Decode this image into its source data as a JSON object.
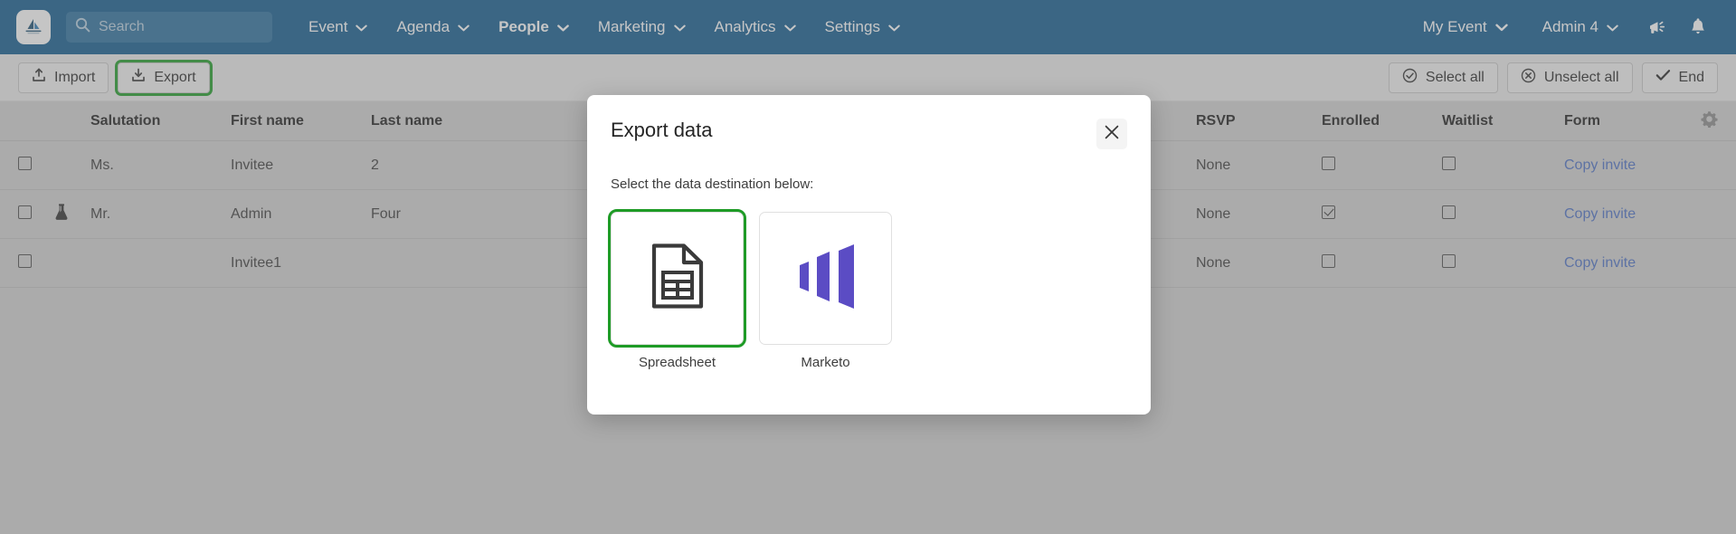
{
  "navbar": {
    "logo_icon": "app-logo-icon",
    "search": {
      "placeholder": "Search",
      "value": "",
      "icon": "search-icon"
    },
    "items": [
      {
        "label": "Event",
        "active": false
      },
      {
        "label": "Agenda",
        "active": false
      },
      {
        "label": "People",
        "active": true
      },
      {
        "label": "Marketing",
        "active": false
      },
      {
        "label": "Analytics",
        "active": false
      },
      {
        "label": "Settings",
        "active": false
      }
    ],
    "right_items": [
      {
        "label": "My Event"
      },
      {
        "label": "Admin 4"
      }
    ],
    "right_icons": [
      "megaphone-icon",
      "bell-icon"
    ],
    "background": "#115a8e"
  },
  "toolbar": {
    "import_label": "Import",
    "export_label": "Export",
    "select_all_label": "Select all",
    "unselect_all_label": "Unselect all",
    "end_label": "End",
    "highlight_color": "#1e9b26"
  },
  "table": {
    "headers": {
      "checkbox": "",
      "flask": "",
      "salutation": "Salutation",
      "first_name": "First name",
      "last_name": "Last name",
      "rsvp": "RSVP",
      "enrolled": "Enrolled",
      "waitlist": "Waitlist",
      "form": "Form",
      "gear": ""
    },
    "rows": [
      {
        "selected": false,
        "flask": false,
        "salutation": "Ms.",
        "first_name": "Invitee",
        "last_name": "2",
        "rsvp": "None",
        "enrolled": false,
        "waitlist": false,
        "form": "Copy invite"
      },
      {
        "selected": false,
        "flask": true,
        "salutation": "Mr.",
        "first_name": "Admin",
        "last_name": "Four",
        "rsvp": "None",
        "enrolled": true,
        "waitlist": false,
        "form": "Copy invite"
      },
      {
        "selected": false,
        "flask": false,
        "salutation": "",
        "first_name": "Invitee1",
        "last_name": "",
        "rsvp": "None",
        "enrolled": false,
        "waitlist": false,
        "form": "Copy invite"
      }
    ]
  },
  "modal": {
    "title": "Export data",
    "close_icon": "close-icon",
    "subtitle": "Select the data destination below:",
    "options": [
      {
        "label": "Spreadsheet",
        "icon": "spreadsheet-icon",
        "selected": true
      },
      {
        "label": "Marketo",
        "icon": "marketo-logo-icon",
        "selected": false,
        "color": "#5b4cc4"
      }
    ]
  }
}
